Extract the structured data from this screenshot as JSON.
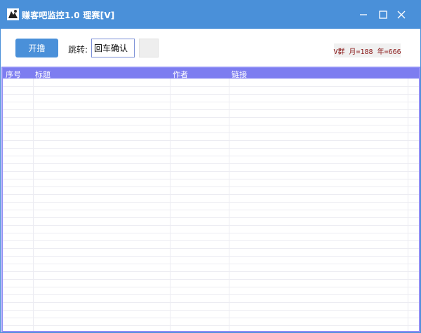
{
  "window": {
    "title": "赚客吧监控1.0 理赛[V]",
    "controls": {
      "minimize": "minimize-icon",
      "maximize": "maximize-icon",
      "close": "close-icon"
    }
  },
  "toolbar": {
    "start_label": "开撸",
    "jump_label": "跳转:",
    "jump_value": "回车确认",
    "blank_button_label": "",
    "group_info": "V群 月=188 年=666"
  },
  "list": {
    "columns": [
      "序号",
      "标题",
      "作者",
      "链接"
    ],
    "rows": []
  },
  "colors": {
    "titlebar": "#4a90d9",
    "accent": "#4a90d9",
    "list_header": "#7d7df0",
    "list_border": "#8f8ff5",
    "group_text": "#8b1a1a"
  }
}
